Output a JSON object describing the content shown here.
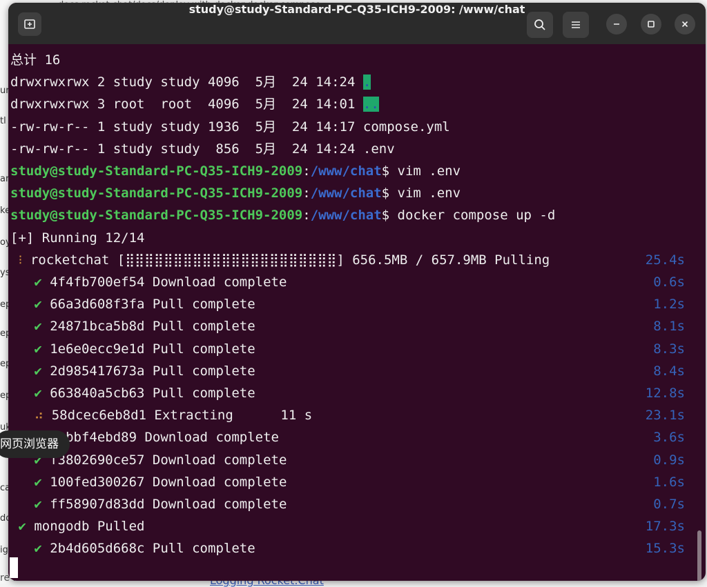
{
  "background": {
    "top_line": "docs.rocket.chat/docs/deploy-with-docker-docker-compose",
    "left_fragments": [
      "ur",
      "tl",
      "ar",
      "ke",
      "oy",
      "ys",
      "ep",
      "ep",
      "ep",
      "ep",
      "uk",
      "ca",
      "do",
      "ig"
    ],
    "bottom_text": "re Rocket.Chat",
    "bottom_link": "Logging Rocket.Chat"
  },
  "window": {
    "title": "study@study-Standard-PC-Q35-ICH9-2009: /www/chat",
    "buttons": [
      "new-tab",
      "search",
      "menu",
      "minimize",
      "maximize",
      "close"
    ]
  },
  "terminal": {
    "lines": [
      {
        "kind": "text",
        "text": "总计 16"
      },
      {
        "kind": "ls",
        "text": "drwxrwxrwx 2 study study 4096  5月  24 14:24 ",
        "dir": "."
      },
      {
        "kind": "ls",
        "text": "drwxrwxrwx 3 root  root  4096  5月  24 14:01 ",
        "dir": ".."
      },
      {
        "kind": "text",
        "text": "-rw-rw-r-- 1 study study 1936  5月  24 14:17 compose.yml"
      },
      {
        "kind": "text",
        "text": "-rw-rw-r-- 1 study study  856  5月  24 14:24 .env"
      },
      {
        "kind": "prompt",
        "user": "study@study-Standard-PC-Q35-ICH9-2009",
        "path": "/www/chat",
        "cmd": "$ vim .env"
      },
      {
        "kind": "prompt",
        "user": "study@study-Standard-PC-Q35-ICH9-2009",
        "path": "/www/chat",
        "cmd": "$ vim .env"
      },
      {
        "kind": "prompt",
        "user": "study@study-Standard-PC-Q35-ICH9-2009",
        "path": "/www/chat",
        "cmd": "$ docker compose up -d"
      },
      {
        "kind": "text",
        "text": "[+] Running 12/14"
      },
      {
        "kind": "layer",
        "indent": " ",
        "mark": "⁝",
        "mark_type": "spin",
        "text": " rocketchat [⣿⣿⣿⣿⣿⣿⣿⣿⣿⣿⣿⣿⣿⣿⣿⣿⣿⣿⣿⣿⣿⣿] 656.5MB / 657.9MB Pulling",
        "time": "25.4s"
      },
      {
        "kind": "layer",
        "indent": "   ",
        "mark": "✔",
        "mark_type": "check",
        "text": " 4f4fb700ef54 Download complete",
        "time": "0.6s"
      },
      {
        "kind": "layer",
        "indent": "   ",
        "mark": "✔",
        "mark_type": "check",
        "text": " 66a3d608f3fa Pull complete",
        "time": "1.2s"
      },
      {
        "kind": "layer",
        "indent": "   ",
        "mark": "✔",
        "mark_type": "check",
        "text": " 24871bca5b8d Pull complete",
        "time": "8.1s"
      },
      {
        "kind": "layer",
        "indent": "   ",
        "mark": "✔",
        "mark_type": "check",
        "text": " 1e6e0ecc9e1d Pull complete",
        "time": "8.3s"
      },
      {
        "kind": "layer",
        "indent": "   ",
        "mark": "✔",
        "mark_type": "check",
        "text": " 2d985417673a Pull complete",
        "time": "8.4s"
      },
      {
        "kind": "layer",
        "indent": "   ",
        "mark": "✔",
        "mark_type": "check",
        "text": " 663840a5cb63 Pull complete",
        "time": "12.8s"
      },
      {
        "kind": "layer",
        "indent": "   ",
        "mark": "⠴",
        "mark_type": "spin",
        "text": " 58dcec6eb8d1 Extracting      11 s",
        "time": "23.1s"
      },
      {
        "kind": "layer",
        "indent": "   ",
        "mark": "✔",
        "mark_type": "check",
        "text": " eebbf4ebd89 Download complete",
        "time": "3.6s"
      },
      {
        "kind": "layer",
        "indent": "   ",
        "mark": "✔",
        "mark_type": "check",
        "text": " f3802690ce57 Download complete",
        "time": "0.9s"
      },
      {
        "kind": "layer",
        "indent": "   ",
        "mark": "✔",
        "mark_type": "check",
        "text": " 100fed300267 Download complete",
        "time": "1.6s"
      },
      {
        "kind": "layer",
        "indent": "   ",
        "mark": "✔",
        "mark_type": "check",
        "text": " ff58907d83dd Download complete",
        "time": "0.7s"
      },
      {
        "kind": "layer",
        "indent": " ",
        "mark": "✔",
        "mark_type": "check",
        "text": " mongodb Pulled",
        "time": "17.3s"
      },
      {
        "kind": "layer",
        "indent": "   ",
        "mark": "✔",
        "mark_type": "check",
        "text": " 2b4d605d668c Pull complete",
        "time": "15.3s"
      }
    ]
  },
  "tooltip": {
    "text": "网页浏览器"
  },
  "colors": {
    "terminal_bg": "#300a24",
    "prompt_user": "#4ec95a",
    "prompt_path": "#3b6ccf",
    "time": "#3563b9",
    "dir_highlight": "#1fa76c"
  }
}
